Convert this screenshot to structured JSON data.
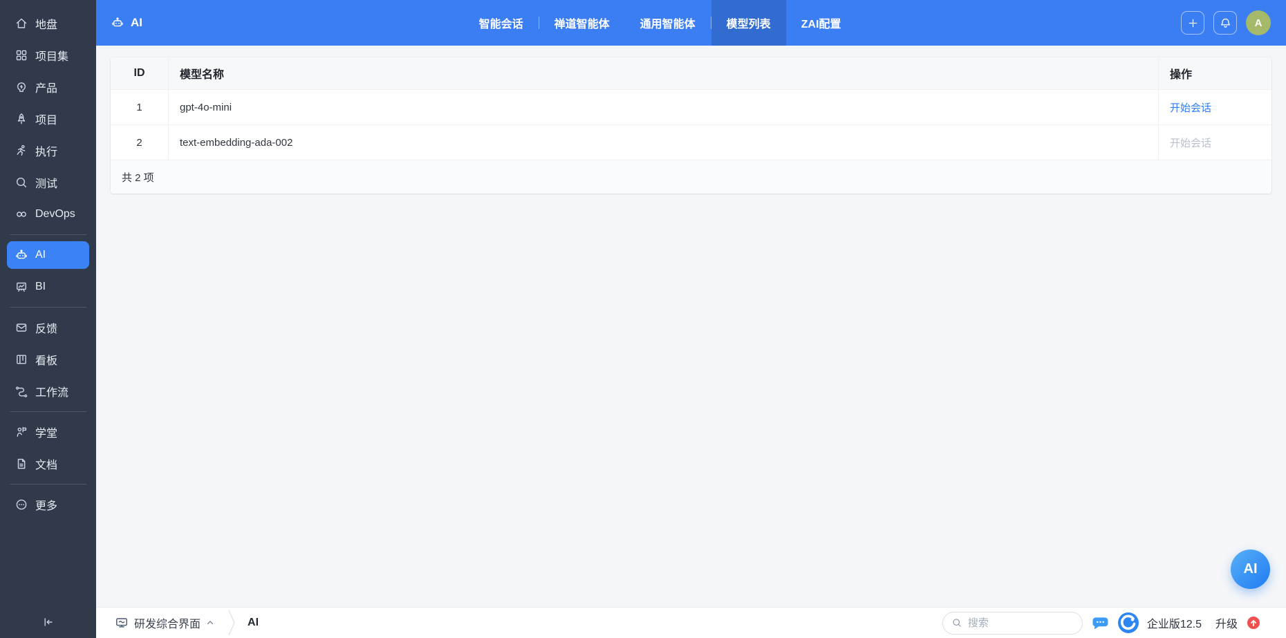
{
  "sidebar": {
    "groups": [
      {
        "items": [
          {
            "id": "home",
            "icon": "home",
            "label": "地盘"
          },
          {
            "id": "program",
            "icon": "grid",
            "label": "项目集"
          },
          {
            "id": "product",
            "icon": "bulb",
            "label": "产品"
          },
          {
            "id": "project",
            "icon": "rocket",
            "label": "项目"
          },
          {
            "id": "execution",
            "icon": "runner",
            "label": "执行"
          },
          {
            "id": "qa",
            "icon": "magnifier",
            "label": "测试"
          },
          {
            "id": "devops",
            "icon": "infinity",
            "label": "DevOps"
          }
        ]
      },
      {
        "items": [
          {
            "id": "ai",
            "icon": "robot",
            "label": "AI",
            "active": true
          },
          {
            "id": "bi",
            "icon": "board",
            "label": "BI"
          }
        ]
      },
      {
        "items": [
          {
            "id": "feedback",
            "icon": "feedback",
            "label": "反馈"
          },
          {
            "id": "kanban",
            "icon": "kanban",
            "label": "看板"
          },
          {
            "id": "workflow",
            "icon": "workflow",
            "label": "工作流"
          }
        ]
      },
      {
        "items": [
          {
            "id": "school",
            "icon": "school",
            "label": "学堂"
          },
          {
            "id": "doc",
            "icon": "doc",
            "label": "文档"
          }
        ]
      },
      {
        "items": [
          {
            "id": "more",
            "icon": "more",
            "label": "更多"
          }
        ]
      }
    ]
  },
  "header": {
    "app_label": "AI",
    "tabs": [
      {
        "id": "smart-chat",
        "label": "智能会话",
        "divider_after": true
      },
      {
        "id": "zentao-agent",
        "label": "禅道智能体"
      },
      {
        "id": "general-agent",
        "label": "通用智能体",
        "divider_after": true
      },
      {
        "id": "model-list",
        "label": "模型列表",
        "active": true
      },
      {
        "id": "zai-config",
        "label": "ZAI配置"
      }
    ],
    "avatar_text": "A"
  },
  "table": {
    "columns": [
      "ID",
      "模型名称",
      "操作"
    ],
    "rows": [
      {
        "id": "1",
        "name": "gpt-4o-mini",
        "action": "开始会话",
        "enabled": true
      },
      {
        "id": "2",
        "name": "text-embedding-ada-002",
        "action": "开始会话",
        "enabled": false
      }
    ],
    "footer": "共 2 项"
  },
  "footer_bar": {
    "workspace": "研发综合界面",
    "breadcrumb_current": "AI",
    "search_placeholder": "搜索",
    "edition": "企业版12.5",
    "upgrade": "升级"
  },
  "floating_button": {
    "label": "AI"
  },
  "colors": {
    "header_blue": "#3b7ef3",
    "sidebar_bg": "#313a4b",
    "accent_blue": "#3b82f6",
    "link_blue": "#2e7cf6",
    "avatar_green": "#a5b96a",
    "badge_red": "#f2504f",
    "fab_blue": "#1e7bf2",
    "disabled_gray": "#b9c0cb"
  }
}
